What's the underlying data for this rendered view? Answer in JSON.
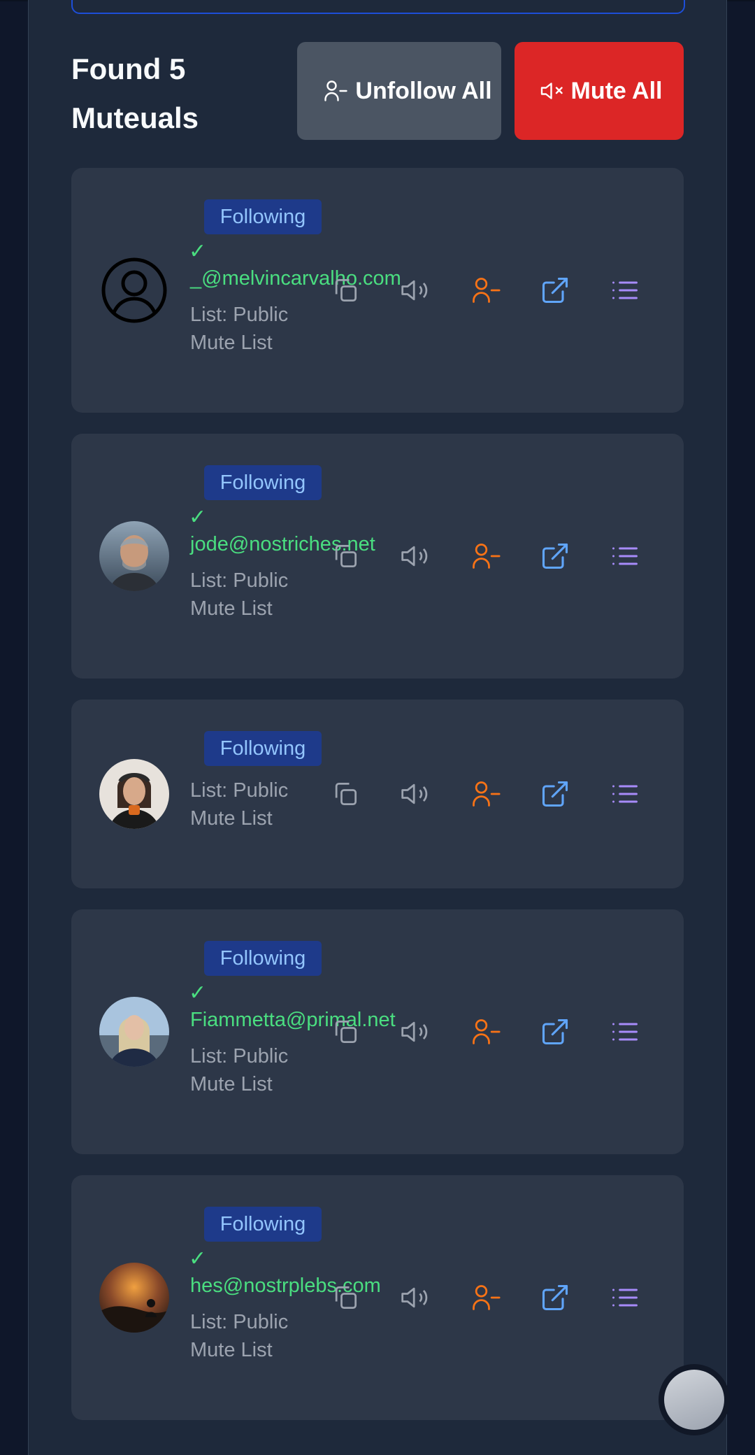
{
  "header": {
    "title": "Found 5 Muteuals",
    "unfollow_all": "Unfollow All",
    "mute_all": "Mute All"
  },
  "accounts": [
    {
      "badge": "Following",
      "check": "✓",
      "nip05": "_@melvincarvalho.com",
      "list": "List: Public Mute List",
      "avatar": "default-user-icon"
    },
    {
      "badge": "Following",
      "check": "✓",
      "nip05": "jode@nostriches.net",
      "list": "List: Public Mute List",
      "avatar": "photo"
    },
    {
      "badge": "Following",
      "check": "",
      "nip05": "",
      "list": "List: Public Mute List",
      "avatar": "photo"
    },
    {
      "badge": "Following",
      "check": "✓",
      "nip05": "Fiammetta@primal.net",
      "list": "List: Public Mute List",
      "avatar": "photo"
    },
    {
      "badge": "Following",
      "check": "✓",
      "nip05": "hes@nostrplebs.com",
      "list": "List: Public Mute List",
      "avatar": "photo"
    }
  ],
  "colors": {
    "copy": "#9ca3af",
    "mute": "#9ca3af",
    "unfollow": "#f97316",
    "open": "#60a5fa",
    "list": "#a78bfa",
    "verified": "#4ade80"
  },
  "icons": [
    "copy-icon",
    "volume-icon",
    "user-minus-icon",
    "external-link-icon",
    "list-icon"
  ]
}
